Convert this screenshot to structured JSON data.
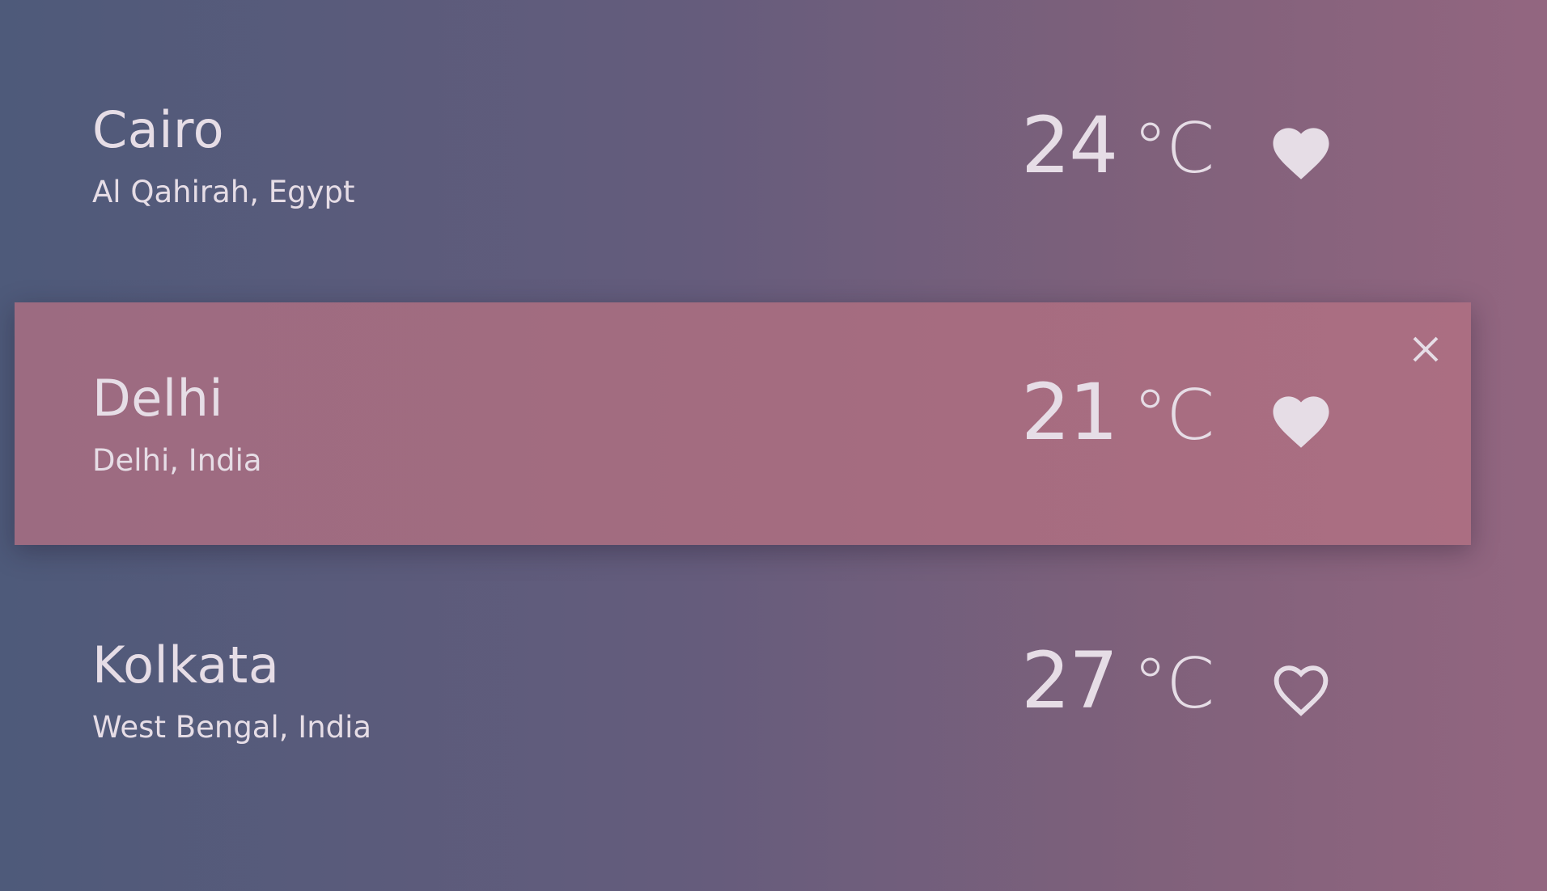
{
  "locations": [
    {
      "city": "Cairo",
      "region": "Al Qahirah, Egypt",
      "temp_value": "24",
      "temp_unit": "°C",
      "favorite": true,
      "icon": "heart-filled-icon"
    },
    {
      "city": "Delhi",
      "region": "Delhi, India",
      "temp_value": "21",
      "temp_unit": "°C",
      "favorite": true,
      "icon": "heart-filled-icon",
      "selected": true,
      "close_icon": "close-icon"
    },
    {
      "city": "Kolkata",
      "region": "West Bengal, India",
      "temp_value": "27",
      "temp_unit": "°C",
      "favorite": false,
      "icon": "heart-outline-icon"
    }
  ],
  "colors": {
    "background_left": "#4e5a7a",
    "background_right": "#936680",
    "selected_row": "#a56c80",
    "text": "#e6dde6"
  }
}
